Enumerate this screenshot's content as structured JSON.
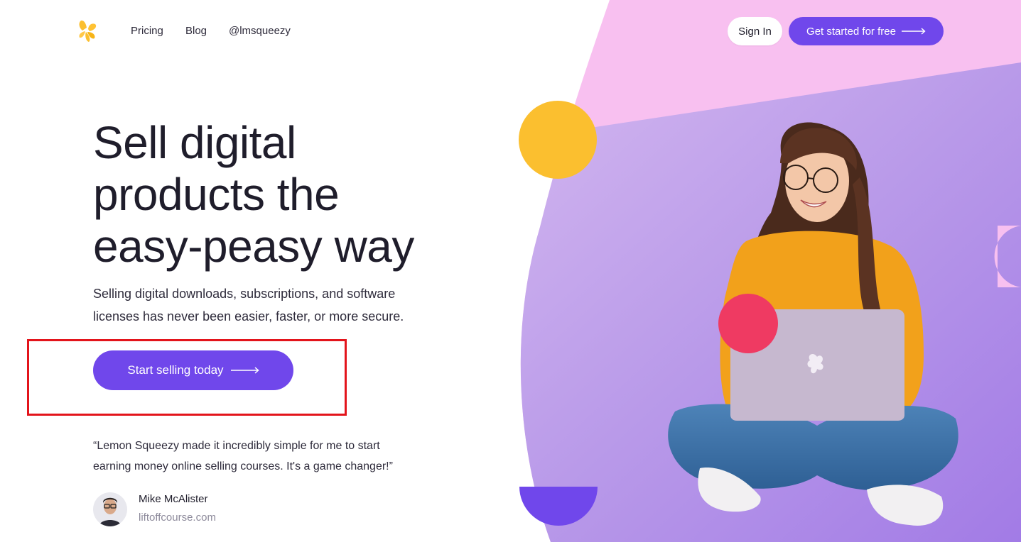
{
  "nav": {
    "links": [
      "Pricing",
      "Blog",
      "@lmsqueezy"
    ],
    "sign_in": "Sign In",
    "get_started": "Get started for free"
  },
  "hero": {
    "headline_lines": [
      "Sell digital",
      "products the",
      "easy-peasy way"
    ],
    "subtext_lines": [
      "Selling digital downloads, subscriptions, and software",
      "licenses has never been easier, faster, or more secure."
    ],
    "cta": "Start selling today"
  },
  "testimonial": {
    "quote_lines": [
      "“Lemon Squeezy made it incredibly simple for me to start",
      "earning money online selling courses. It's a game changer!”"
    ],
    "author": "Mike McAlister",
    "site": "liftoffcourse.com"
  },
  "colors": {
    "accent": "#7047eb",
    "pink_bg": "#f8c0f0",
    "lavender": "#b49be8",
    "yellow": "#fbbf2f",
    "coral": "#ef3a62",
    "highlight": "#e3141b"
  },
  "icons": {
    "logo": "lemon-squeezy-logo-icon",
    "arrow": "long-arrow-right-icon"
  }
}
